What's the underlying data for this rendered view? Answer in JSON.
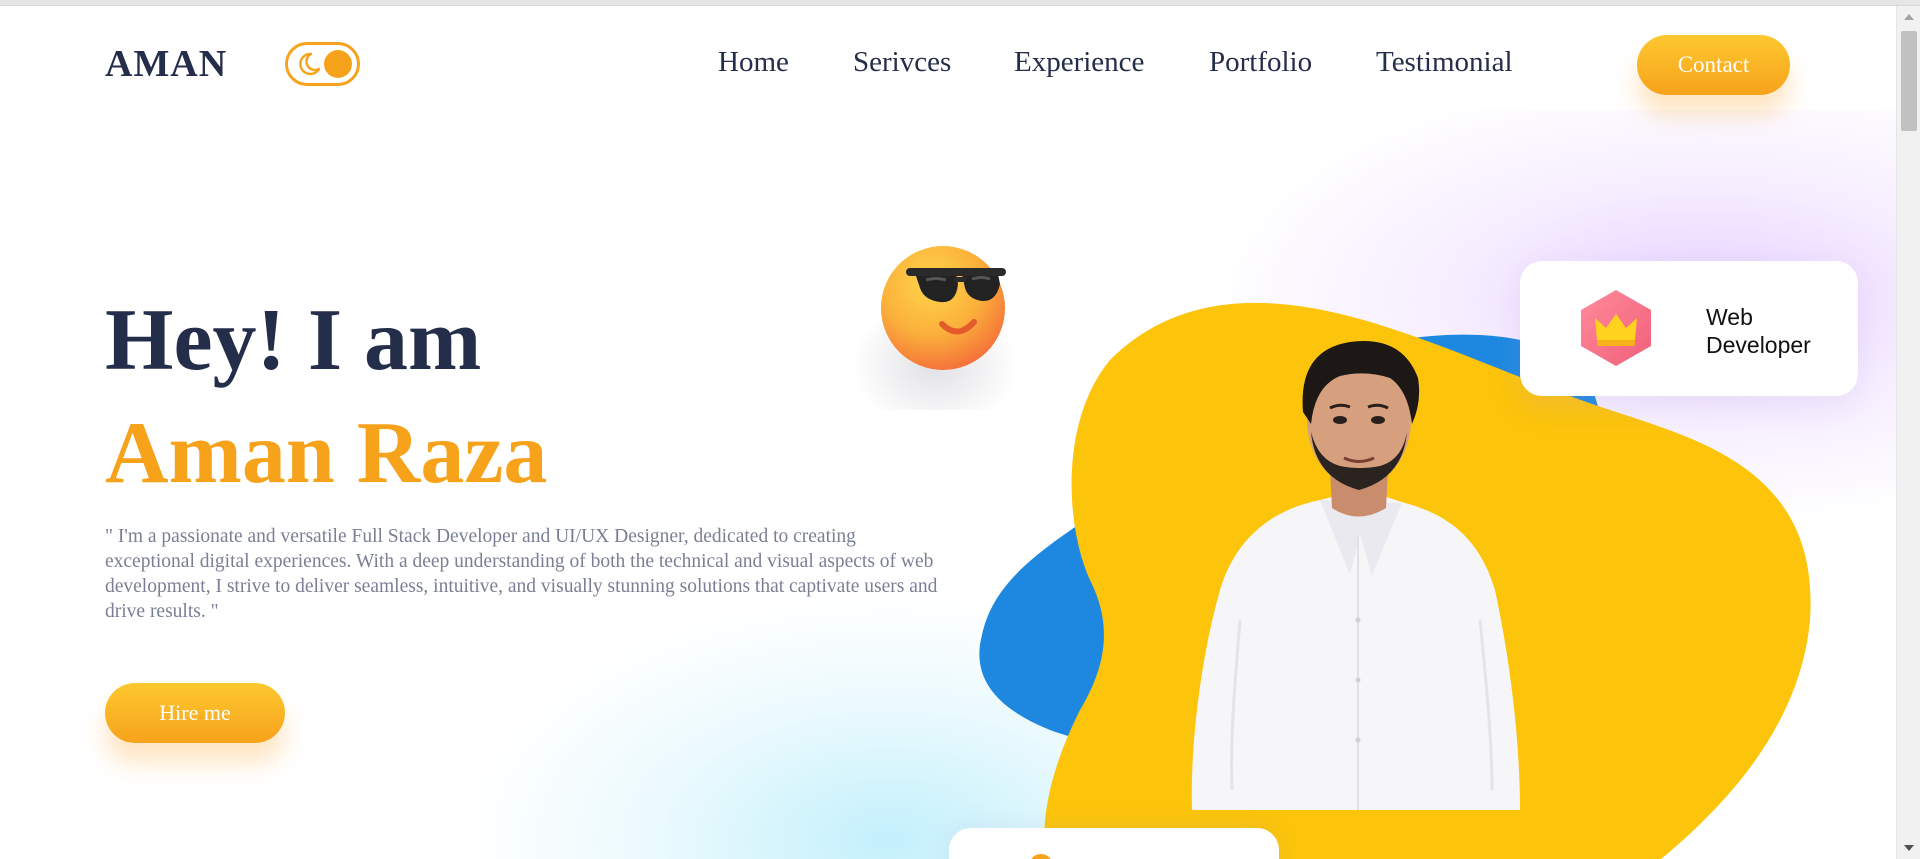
{
  "header": {
    "logo": "AMAN",
    "theme_toggle_icon": "moon-icon",
    "nav": [
      {
        "label": "Home"
      },
      {
        "label": "Serivces"
      },
      {
        "label": "Experience"
      },
      {
        "label": "Portfolio"
      },
      {
        "label": "Testimonial"
      }
    ],
    "contact_label": "Contact"
  },
  "hero": {
    "greeting": "Hey! I am",
    "name": "Aman Raza",
    "description": "\" I'm a passionate and versatile Full Stack Developer and UI/UX Designer, dedicated to creating exceptional digital experiences. With a deep understanding of both the technical and visual aspects of web development, I strive to deliver seamless, intuitive, and visually stunning solutions that captivate users and drive results. \"",
    "hire_label": "Hire me",
    "emoji_icon": "sunglasses-emoji-icon"
  },
  "cards": {
    "web": {
      "icon": "crown-icon",
      "label": "Web Developer"
    },
    "bottom": {
      "icon": "orange-dot-icon"
    }
  },
  "colors": {
    "accent": "#f7a21b",
    "accent_light": "#fdc830",
    "heading": "#242d49",
    "text_muted": "#7a7f94",
    "blob_yellow": "#fcc40a",
    "blob_blue": "#1e88e0"
  }
}
